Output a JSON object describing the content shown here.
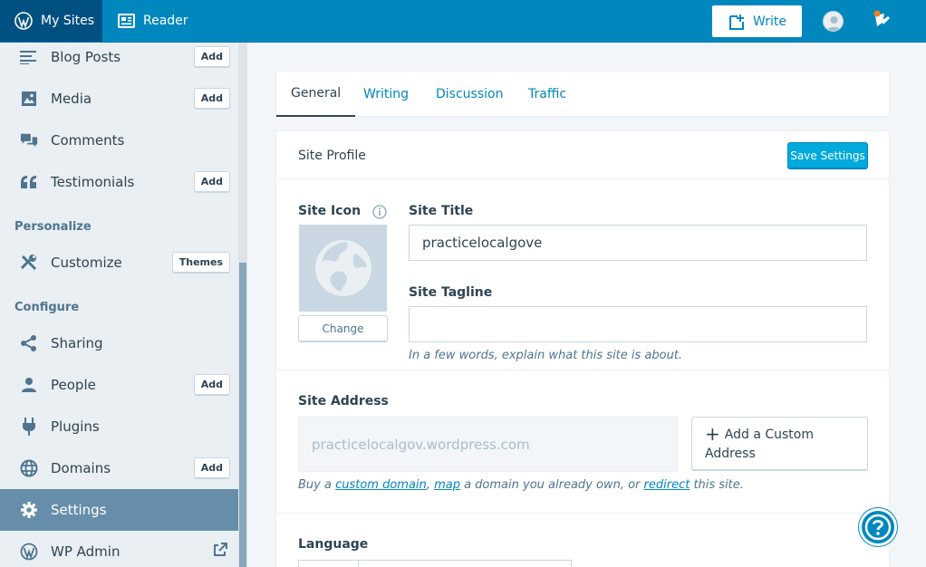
{
  "masterbar": {
    "my_sites": "My Sites",
    "reader": "Reader",
    "write": "Write",
    "icons": [
      "wordpress-logo-icon",
      "reader-icon",
      "write-icon",
      "user-avatar",
      "notifications-icon"
    ]
  },
  "sidebar": {
    "items": [
      {
        "label": "Blog Posts",
        "button": "Add",
        "icon": "posts-icon"
      },
      {
        "label": "Media",
        "button": "Add",
        "icon": "media-icon"
      },
      {
        "label": "Comments",
        "button": "",
        "icon": "comments-icon"
      },
      {
        "label": "Testimonials",
        "button": "Add",
        "icon": "quote-icon"
      },
      {
        "label": "Customize",
        "button": "Themes",
        "icon": "tools-icon"
      },
      {
        "label": "Sharing",
        "button": "",
        "icon": "share-icon"
      },
      {
        "label": "People",
        "button": "Add",
        "icon": "person-icon"
      },
      {
        "label": "Plugins",
        "button": "",
        "icon": "plugin-icon"
      },
      {
        "label": "Domains",
        "button": "Add",
        "icon": "globe-icon"
      },
      {
        "label": "Settings",
        "button": "",
        "icon": "gear-icon"
      },
      {
        "label": "WP Admin",
        "button": "",
        "icon": "wordpress-icon"
      }
    ],
    "headings": {
      "personalize": "Personalize",
      "configure": "Configure"
    },
    "selected": "Settings"
  },
  "tabs": [
    {
      "label": "General",
      "active": true
    },
    {
      "label": "Writing",
      "active": false
    },
    {
      "label": "Discussion",
      "active": false
    },
    {
      "label": "Traffic",
      "active": false
    }
  ],
  "site_profile": {
    "title": "Site Profile",
    "save_label": "Save Settings"
  },
  "site_settings": {
    "site_icon_label": "Site Icon",
    "change_label": "Change",
    "site_title_label": "Site Title",
    "site_title_value": "practicelocalgove",
    "site_tagline_label": "Site Tagline",
    "site_tagline_value": "",
    "tagline_hint": "In a few words, explain what this site is about."
  },
  "site_address": {
    "label": "Site Address",
    "value": "practicelocalgov.wordpress.com",
    "custom_button": "Add a Custom Address",
    "hint_prefix": "Buy a ",
    "hint_link1": "custom domain",
    "hint_sep": ", ",
    "hint_link2": "map",
    "hint_mid": " a domain you already own, or ",
    "hint_link3": "redirect",
    "hint_suffix": " this site."
  },
  "language": {
    "label": "Language"
  },
  "colors": {
    "masterbar": "#0087be",
    "my_sites_bg": "#005082",
    "sidebar_bg": "#e9eff3",
    "selected_bg": "#668eaa",
    "accent": "#00aadc"
  }
}
